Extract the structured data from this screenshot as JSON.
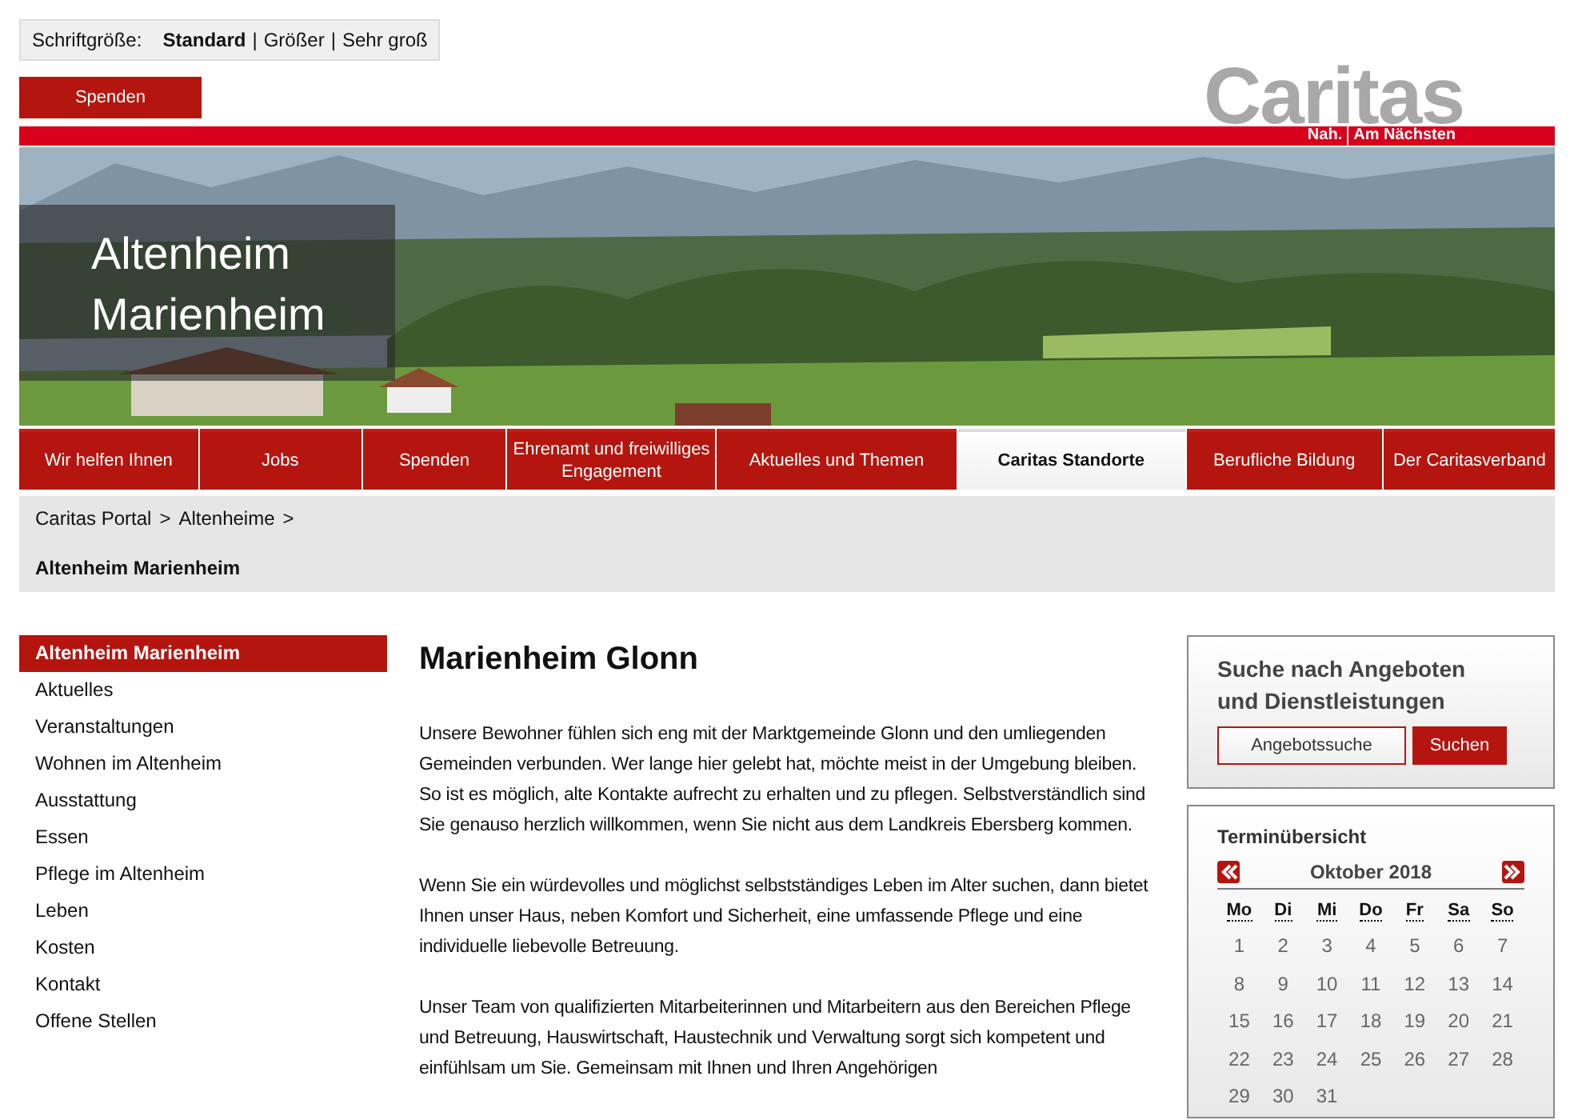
{
  "font_size": {
    "label": "Schriftgröße:",
    "options": [
      {
        "label": "Standard",
        "selected": true
      },
      {
        "label": "Größer",
        "selected": false
      },
      {
        "label": "Sehr groß",
        "selected": false
      }
    ]
  },
  "font_size_separator": "|",
  "donate_button": "Spenden",
  "logo": {
    "name": "Caritas",
    "tagline": [
      "Nah.",
      "Am Nächsten"
    ]
  },
  "hero": {
    "title": "Altenheim Marienheim"
  },
  "nav": [
    {
      "label": "Wir helfen Ihnen",
      "selected": false
    },
    {
      "label": "Jobs",
      "selected": false
    },
    {
      "label": "Spenden",
      "selected": false
    },
    {
      "label": "Ehrenamt und freiwilliges Engagement",
      "selected": false
    },
    {
      "label": "Aktuelles und Themen",
      "selected": false
    },
    {
      "label": "Caritas Standorte",
      "selected": true
    },
    {
      "label": "Berufliche Bildung",
      "selected": false
    },
    {
      "label": "Der Caritasverband",
      "selected": false
    }
  ],
  "breadcrumb": [
    {
      "label": "Caritas Portal",
      "current": false
    },
    {
      "label": "Altenheime",
      "current": false
    },
    {
      "label": "Altenheim Marienheim",
      "current": true
    }
  ],
  "breadcrumb_separator": ">",
  "sidebar": {
    "items": [
      {
        "label": "Altenheim Marienheim",
        "selected": true
      },
      {
        "label": "Aktuelles",
        "selected": false
      },
      {
        "label": "Veranstaltungen",
        "selected": false
      },
      {
        "label": "Wohnen im Altenheim",
        "selected": false
      },
      {
        "label": "Ausstattung",
        "selected": false
      },
      {
        "label": "Essen",
        "selected": false
      },
      {
        "label": "Pflege im Altenheim",
        "selected": false
      },
      {
        "label": "Leben",
        "selected": false
      },
      {
        "label": "Kosten",
        "selected": false
      },
      {
        "label": "Kontakt",
        "selected": false
      },
      {
        "label": "Offene Stellen",
        "selected": false
      }
    ]
  },
  "article": {
    "title": "Marienheim Glonn",
    "paragraphs": [
      "Unsere Bewohner fühlen sich eng mit der Marktgemeinde Glonn und den umliegenden Gemeinden verbunden. Wer lange hier gelebt hat, möchte meist in der Umgebung bleiben. So ist es möglich, alte Kontakte aufrecht zu erhalten und zu pflegen. Selbstverständlich sind Sie genauso herzlich willkommen, wenn Sie nicht aus dem Landkreis Ebersberg kommen.",
      "Wenn Sie ein würdevolles und möglichst selbstständiges Leben im Alter suchen, dann bietet Ihnen unser Haus, neben Komfort und Sicherheit, eine umfassende Pflege und eine individuelle liebevolle Betreuung.",
      "Unser Team von qualifizierten Mitarbeiterinnen und Mitarbeitern aus den Bereichen Pflege und Betreuung, Hauswirtschaft, Haustechnik und Verwaltung sorgt sich kompetent und einfühlsam um Sie. Gemeinsam mit Ihnen und Ihren Angehörigen"
    ]
  },
  "search_box": {
    "title": "Suche nach Angeboten und Dienstleistungen",
    "field": {
      "placeholder": "Angebotssuche"
    },
    "button": "Suchen"
  },
  "calendar": {
    "title": "Terminübersicht",
    "month": "Oktober 2018",
    "weekdays": [
      "Mo",
      "Di",
      "Mi",
      "Do",
      "Fr",
      "Sa",
      "So"
    ],
    "weeks": [
      [
        "1",
        "2",
        "3",
        "4",
        "5",
        "6",
        "7"
      ],
      [
        "8",
        "9",
        "10",
        "11",
        "12",
        "13",
        "14"
      ],
      [
        "15",
        "16",
        "17",
        "18",
        "19",
        "20",
        "21"
      ],
      [
        "22",
        "23",
        "24",
        "25",
        "26",
        "27",
        "28"
      ],
      [
        "29",
        "30",
        "31"
      ]
    ]
  }
}
